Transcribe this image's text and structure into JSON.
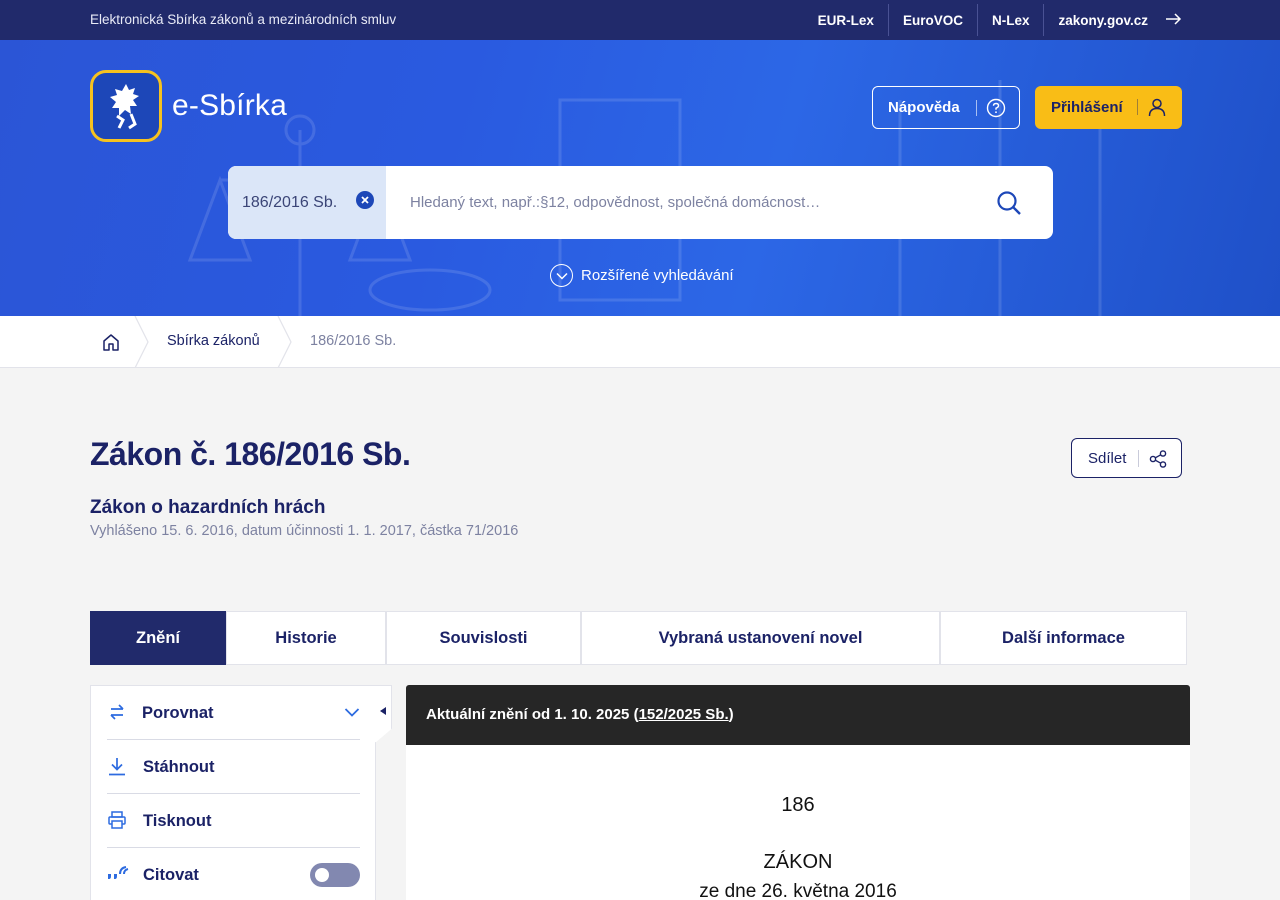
{
  "topbar": {
    "title": "Elektronická Sbírka zákonů a mezinárodních smluv",
    "links": [
      "EUR-Lex",
      "EuroVOC",
      "N-Lex",
      "zakony.gov.cz"
    ]
  },
  "header": {
    "logo_text": "e-Sbírka",
    "help_label": "Nápověda",
    "login_label": "Přihlášení"
  },
  "search": {
    "chip": "186/2016 Sb.",
    "placeholder": "Hledaný text, např.:§12, odpovědnost, společná domácnost…",
    "advanced_label": "Rozšířené vyhledávání"
  },
  "breadcrumb": {
    "items": [
      "Sbírka zákonů",
      "186/2016 Sb."
    ]
  },
  "document": {
    "title": "Zákon č. 186/2016 Sb.",
    "subtitle": "Zákon o hazardních hrách",
    "meta": "Vyhlášeno 15. 6. 2016, datum účinnosti 1. 1. 2017, částka 71/2016",
    "share_label": "Sdílet"
  },
  "tabs": [
    {
      "label": "Znění",
      "active": true
    },
    {
      "label": "Historie",
      "active": false
    },
    {
      "label": "Souvislosti",
      "active": false
    },
    {
      "label": "Vybraná ustanovení novel",
      "active": false
    },
    {
      "label": "Další informace",
      "active": false
    }
  ],
  "sidebar": {
    "items": [
      {
        "label": "Porovnat",
        "icon": "swap-icon"
      },
      {
        "label": "Stáhnout",
        "icon": "download-icon"
      },
      {
        "label": "Tisknout",
        "icon": "printer-icon"
      },
      {
        "label": "Citovat",
        "icon": "quote-icon",
        "toggle": false
      }
    ]
  },
  "banner": {
    "prefix": "Aktuální znění od 1. 10. 2025 (",
    "link": "152/2025 Sb.",
    "suffix": ")"
  },
  "body": {
    "number": "186",
    "kind": "ZÁKON",
    "date": "ze dne 26. května 2016"
  },
  "colors": {
    "navy": "#212a6b",
    "accent_yellow": "#f9bd16",
    "hero_blue": "#2a5ae0",
    "banner_dark": "#262626"
  }
}
